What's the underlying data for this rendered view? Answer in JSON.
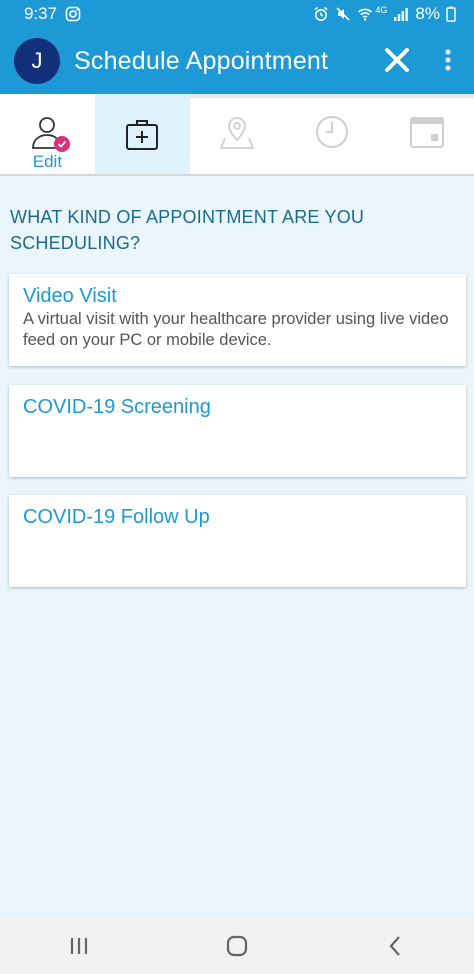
{
  "status_bar": {
    "time": "9:37",
    "network": "4G",
    "battery": "8%"
  },
  "app_bar": {
    "avatar_initial": "J",
    "title": "Schedule Appointment"
  },
  "steps": [
    {
      "icon": "user-icon",
      "label": "Edit",
      "state": "completed"
    },
    {
      "icon": "medical-kit-icon",
      "label": "",
      "state": "active"
    },
    {
      "icon": "map-pin-icon",
      "label": "",
      "state": "disabled"
    },
    {
      "icon": "clock-icon",
      "label": "",
      "state": "disabled"
    },
    {
      "icon": "calendar-icon",
      "label": "",
      "state": "disabled"
    }
  ],
  "main": {
    "question": "WHAT KIND OF APPOINTMENT ARE YOU SCHEDULING?",
    "options": [
      {
        "title": "Video Visit",
        "description": "A virtual visit with your healthcare provider using live video feed on your PC or mobile device."
      },
      {
        "title": "COVID-19 Screening",
        "description": ""
      },
      {
        "title": "COVID-19 Follow Up",
        "description": ""
      }
    ]
  },
  "colors": {
    "primary": "#1d9ad6",
    "avatar": "#13307a",
    "badge": "#d9307c",
    "background": "#eaf6fc",
    "question_text": "#1a6b8a"
  }
}
